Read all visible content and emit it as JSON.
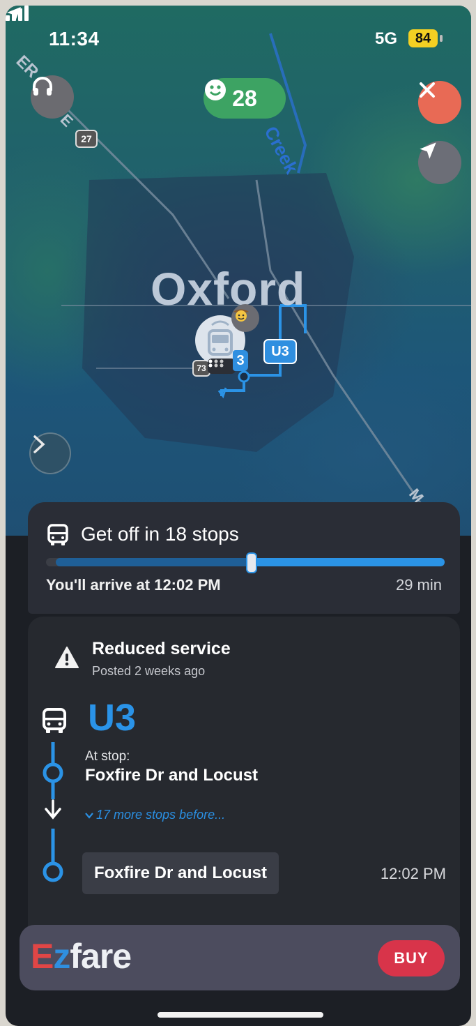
{
  "status_bar": {
    "time": "11:34",
    "network": "5G",
    "battery": "84"
  },
  "map": {
    "score": "28",
    "city": "Oxford",
    "street_labels": [
      "Creek",
      "ER",
      "E",
      "M"
    ],
    "highway_shields": [
      "27",
      "73"
    ],
    "route_badges": [
      "U3",
      "3"
    ]
  },
  "trip": {
    "title": "Get off in 18 stops",
    "arrival": "You'll arrive at 12:02 PM",
    "duration": "29 min",
    "progress": 0.5
  },
  "alert": {
    "title": "Reduced service",
    "posted": "Posted 2 weeks ago"
  },
  "route": {
    "name": "U3",
    "at_stop_label": "At stop:",
    "at_stop_name": "Foxfire Dr and Locust",
    "more_stops": "17 more stops before...",
    "destination": "Foxfire Dr and Locust",
    "destination_time": "12:02 PM"
  },
  "ezfare": {
    "logo_ez": "E",
    "logo_z": "z",
    "logo_rest": "fare",
    "buy_label": "BUY"
  },
  "colors": {
    "accent_blue": "#2a93e8",
    "buy_red": "#d8344a",
    "score_green": "#3da363",
    "close_orange": "#e86a55"
  }
}
